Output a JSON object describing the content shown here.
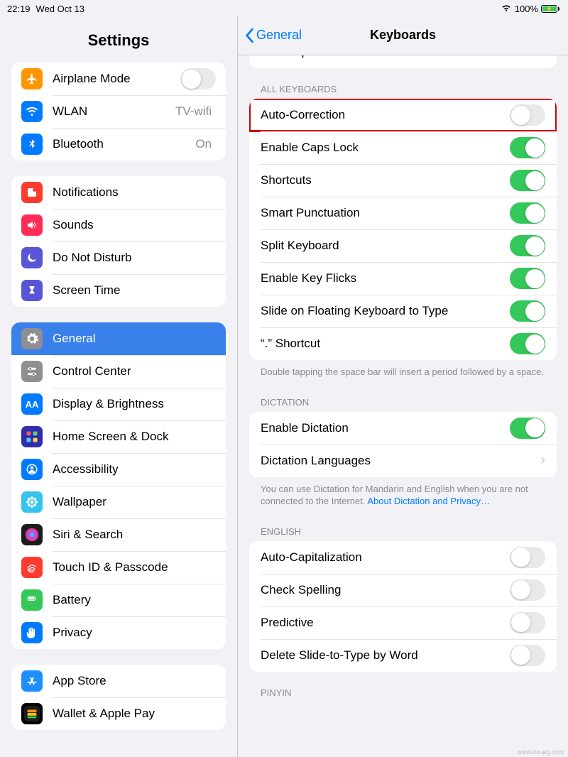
{
  "status": {
    "time": "22:19",
    "date": "Wed Oct 13",
    "battery_pct": "100%"
  },
  "sidebar": {
    "title": "Settings",
    "groups": [
      {
        "rows": [
          {
            "icon": "airplane",
            "bg": "#ff9500",
            "label": "Airplane Mode",
            "trailing": {
              "type": "toggle",
              "on": false
            }
          },
          {
            "icon": "wifi",
            "bg": "#007aff",
            "label": "WLAN",
            "trailing": {
              "type": "value",
              "text": "TV-wifi"
            }
          },
          {
            "icon": "bluetooth",
            "bg": "#007aff",
            "label": "Bluetooth",
            "trailing": {
              "type": "value",
              "text": "On"
            }
          }
        ]
      },
      {
        "rows": [
          {
            "icon": "bell",
            "bg": "#ff3b30",
            "label": "Notifications"
          },
          {
            "icon": "speaker",
            "bg": "#ff2d55",
            "label": "Sounds"
          },
          {
            "icon": "moon",
            "bg": "#5856d6",
            "label": "Do Not Disturb"
          },
          {
            "icon": "hourglass",
            "bg": "#5856d6",
            "label": "Screen Time"
          }
        ]
      },
      {
        "rows": [
          {
            "icon": "gear",
            "bg": "#8e8e93",
            "label": "General",
            "selected": true
          },
          {
            "icon": "sliders",
            "bg": "#8e8e93",
            "label": "Control Center"
          },
          {
            "icon": "aa",
            "bg": "#007aff",
            "label": "Display & Brightness"
          },
          {
            "icon": "grid",
            "bg": "#2f2ead",
            "label": "Home Screen & Dock"
          },
          {
            "icon": "person",
            "bg": "#007aff",
            "label": "Accessibility"
          },
          {
            "icon": "flower",
            "bg": "#33c5ef",
            "label": "Wallpaper"
          },
          {
            "icon": "siri",
            "bg": "#1c1c1e",
            "label": "Siri & Search"
          },
          {
            "icon": "touchid",
            "bg": "#ff3b30",
            "label": "Touch ID & Passcode"
          },
          {
            "icon": "battery",
            "bg": "#34c759",
            "label": "Battery"
          },
          {
            "icon": "hand",
            "bg": "#007aff",
            "label": "Privacy"
          }
        ]
      },
      {
        "rows": [
          {
            "icon": "appstore",
            "bg": "#1f8fff",
            "label": "App Store"
          },
          {
            "icon": "wallet",
            "bg": "#000000",
            "label": "Wallet & Apple Pay"
          }
        ]
      }
    ]
  },
  "detail": {
    "back": "General",
    "title": "Keyboards",
    "truncated_top": "Text Replacement",
    "sections": [
      {
        "header": "ALL KEYBOARDS",
        "rows": [
          {
            "label": "Auto-Correction",
            "toggle": false,
            "highlight": true
          },
          {
            "label": "Enable Caps Lock",
            "toggle": true
          },
          {
            "label": "Shortcuts",
            "toggle": true
          },
          {
            "label": "Smart Punctuation",
            "toggle": true
          },
          {
            "label": "Split Keyboard",
            "toggle": true
          },
          {
            "label": "Enable Key Flicks",
            "toggle": true
          },
          {
            "label": "Slide on Floating Keyboard to Type",
            "toggle": true
          },
          {
            "label": "“.” Shortcut",
            "toggle": true
          }
        ],
        "footer": "Double tapping the space bar will insert a period followed by a space."
      },
      {
        "header": "DICTATION",
        "rows": [
          {
            "label": "Enable Dictation",
            "toggle": true
          },
          {
            "label": "Dictation Languages",
            "disclosure": true
          }
        ],
        "footer": "You can use Dictation for Mandarin and English when you are not connected to the Internet. ",
        "footer_link": "About Dictation and Privacy…"
      },
      {
        "header": "ENGLISH",
        "rows": [
          {
            "label": "Auto-Capitalization",
            "toggle": false
          },
          {
            "label": "Check Spelling",
            "toggle": false
          },
          {
            "label": "Predictive",
            "toggle": false
          },
          {
            "label": "Delete Slide-to-Type by Word",
            "toggle": false
          }
        ]
      },
      {
        "header": "PINYIN",
        "rows": []
      }
    ]
  },
  "watermark": "www.dxueg.com"
}
